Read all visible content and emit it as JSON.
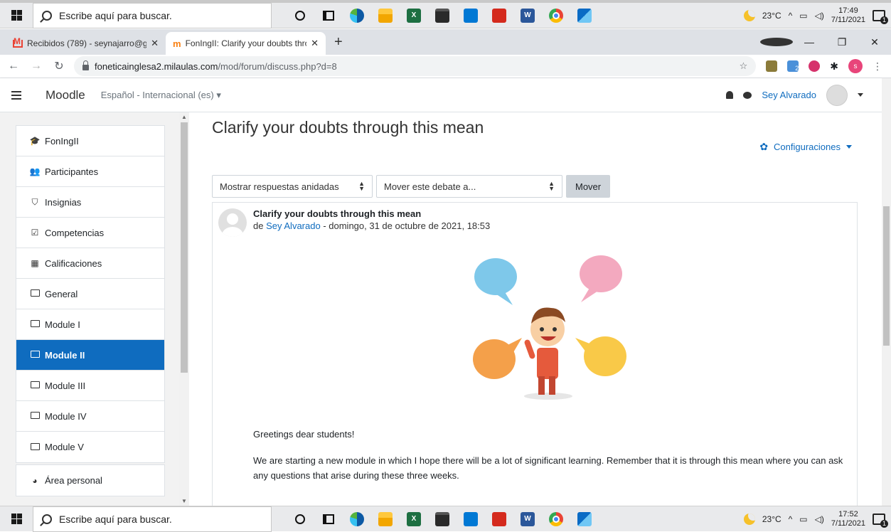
{
  "taskbar": {
    "search_placeholder": "Escribe aquí para buscar.",
    "temperature": "23°C",
    "top_time": "17:49",
    "top_date": "7/11/2021",
    "bottom_time": "17:52",
    "bottom_date": "7/11/2021",
    "notification_count": "1"
  },
  "browser": {
    "tabs": [
      {
        "label": "Recibidos (789) - seynajarro@gm",
        "icon": "gmail-icon"
      },
      {
        "label": "FonIngII: Clarify your doubts thro",
        "icon": "moodle-icon"
      }
    ],
    "url_host": "foneticainglesa2.milaulas.com",
    "url_path": "/mod/forum/discuss.php?d=8",
    "profile_initial": "s",
    "ext_badge": "2"
  },
  "moodle": {
    "brand": "Moodle",
    "language": "Español - Internacional (es)",
    "user_name": "Sey Alvarado"
  },
  "sidebar": {
    "items": [
      {
        "label": "FonIngII",
        "icon": "graduation-cap-icon"
      },
      {
        "label": "Participantes",
        "icon": "users-icon"
      },
      {
        "label": "Insignias",
        "icon": "shield-icon"
      },
      {
        "label": "Competencias",
        "icon": "checkbox-icon"
      },
      {
        "label": "Calificaciones",
        "icon": "table-icon"
      },
      {
        "label": "General",
        "icon": "folder-icon"
      },
      {
        "label": "Module I",
        "icon": "folder-icon"
      },
      {
        "label": "Module II",
        "icon": "folder-icon",
        "active": true
      },
      {
        "label": "Module III",
        "icon": "folder-icon"
      },
      {
        "label": "Module IV",
        "icon": "folder-icon"
      },
      {
        "label": "Module V",
        "icon": "folder-icon"
      }
    ],
    "personal": {
      "label": "Área personal",
      "icon": "tachometer-icon"
    }
  },
  "main": {
    "title": "Clarify your doubts through this mean",
    "settings_label": "Configuraciones",
    "display_mode": "Mostrar respuestas anidadas",
    "move_select": "Mover este debate a...",
    "move_button": "Mover",
    "post": {
      "subject": "Clarify your doubts through this mean",
      "by_prefix": "de",
      "author": "Sey Alvarado",
      "date": "- domingo, 31 de octubre de 2021, 18:53",
      "greeting": "Greetings dear students!",
      "body": "We are starting a new module in which I hope there will be a lot of significant learning. Remember that it is through this mean where you can ask any questions that arise during these three weeks."
    }
  }
}
